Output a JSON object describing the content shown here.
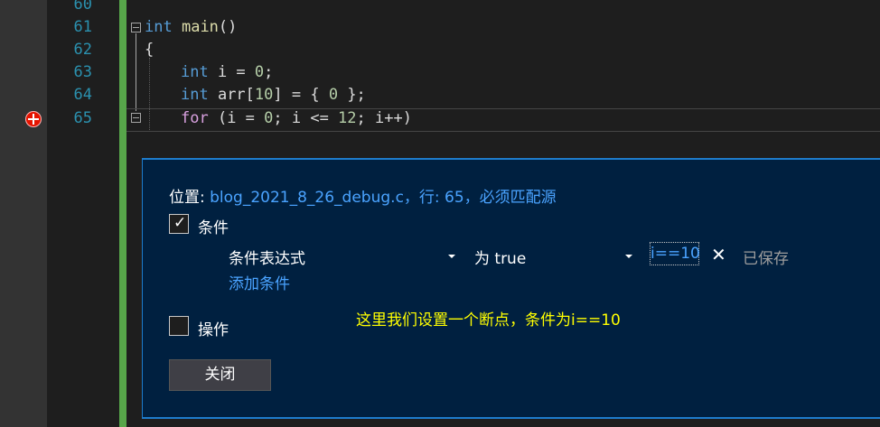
{
  "editor": {
    "line_numbers": [
      "60",
      "61",
      "62",
      "63",
      "64",
      "65"
    ],
    "code": {
      "line61": {
        "kw": "int",
        "fn": "main",
        "rest": "()"
      },
      "line62": {
        "text": "{"
      },
      "line63": {
        "kw": "int",
        "name": " i = ",
        "num": "0",
        "end": ";"
      },
      "line64": {
        "kw": "int",
        "name": " arr",
        "open": "[",
        "num": "10",
        "close": "] = { ",
        "num2": "0",
        "end": " };"
      },
      "line65": {
        "kw": "for",
        "a": " (i = ",
        "n1": "0",
        "b": "; i <= ",
        "n2": "12",
        "c": "; i++)"
      }
    }
  },
  "breakpoint_settings": {
    "location_label": "位置: ",
    "location_value": "blog_2021_8_26_debug.c，行: 65，必须匹配源",
    "conditions_label": "条件",
    "condition_type": "条件表达式",
    "condition_mode": "为 true",
    "condition_expr": "i==10",
    "close_glyph": "✕",
    "saved_label": "已保存",
    "add_condition": "添加条件",
    "actions_label": "操作",
    "close_button": "关闭",
    "conditions_checked": true,
    "actions_checked": false
  },
  "annotation": "这里我们设置一个断点，条件为i==10",
  "colors": {
    "accent": "#1e7ccc",
    "panel_bg": "#002040",
    "link": "#4aa3ff",
    "breakpoint": "#e51400",
    "annotation": "#ffff00"
  },
  "icons": [
    "breakpoint-icon",
    "collapse-icon",
    "checkbox-checked-icon",
    "checkbox-unchecked-icon",
    "dropdown-caret-icon",
    "close-icon"
  ]
}
